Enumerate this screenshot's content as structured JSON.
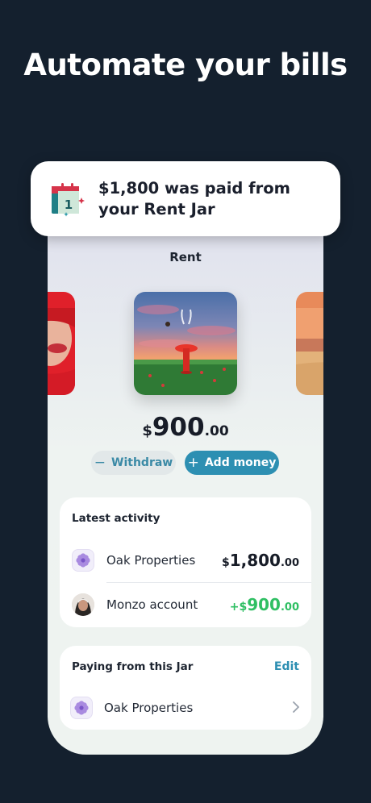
{
  "headline": "Automate your bills",
  "notification": {
    "text": "$1,800 was paid from your Rent Jar",
    "icon": "calendar-day-1-icon"
  },
  "jar": {
    "title": "Rent",
    "balance": {
      "currency": "$",
      "whole": "900",
      "cents": ".00"
    },
    "withdraw": {
      "symbol": "−",
      "label": "Withdraw"
    },
    "add_money": {
      "symbol": "+",
      "label": "Add money"
    }
  },
  "latest_activity": {
    "heading": "Latest activity",
    "items": [
      {
        "name": "Oak Properties",
        "sign": "",
        "currency": "$",
        "whole": "1,800",
        "cents": ".00",
        "icon": "flower-icon"
      },
      {
        "name": "Monzo account",
        "sign": "+",
        "currency": "$",
        "whole": "900",
        "cents": ".00",
        "icon": "person-avatar"
      }
    ]
  },
  "paying": {
    "heading": "Paying from this Jar",
    "edit_label": "Edit",
    "items": [
      {
        "name": "Oak Properties",
        "icon": "flower-icon"
      }
    ]
  },
  "colors": {
    "background": "#14202e",
    "accent": "#2d8fb2",
    "positive": "#2fbf63"
  }
}
